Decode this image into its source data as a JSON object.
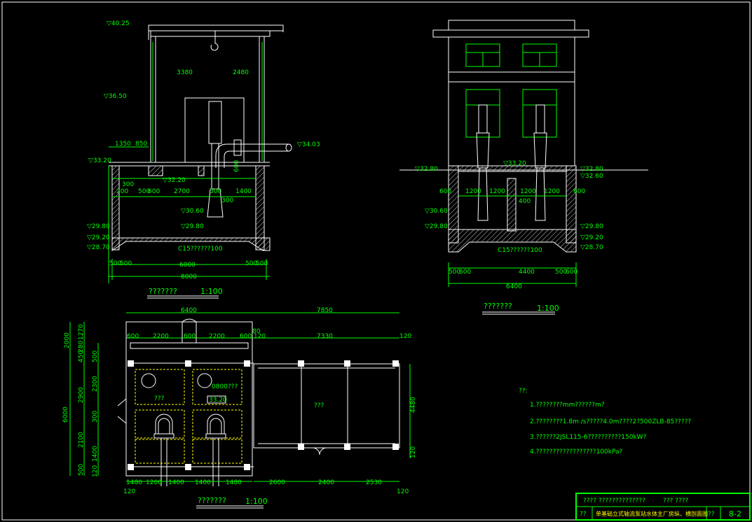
{
  "section": {
    "elevations": [
      "▽40.25",
      "▽36.50",
      "▽34.03",
      "▽33.20",
      "▽32.20",
      "▽30.60",
      "▽29.80",
      "▽29.80",
      "▽29.20",
      "▽28.70"
    ],
    "dims": [
      "3380",
      "2480",
      "1350",
      "850",
      "300",
      "200",
      "500",
      "600",
      "2700",
      "300",
      "1400",
      "300",
      "500",
      "500",
      "6000",
      "500",
      "500",
      "8000"
    ],
    "pipe_dim": "600",
    "concrete_note": "C15??????100",
    "title": "???????",
    "scale": "1:100"
  },
  "elevation": {
    "elevations": [
      "▽32.80",
      "▽33.20",
      "▽32.80",
      "▽32.60",
      "▽30.60",
      "▽29.80",
      "▽29.80",
      "▽29.20",
      "▽28.70"
    ],
    "dims": [
      "600",
      "1200",
      "1200",
      "1200",
      "1200",
      "600",
      "400",
      "500",
      "600",
      "4400",
      "500",
      "600",
      "6400"
    ],
    "concrete_note": "C15??????100",
    "title": "???????",
    "scale": "1:100"
  },
  "plan": {
    "dims_top": [
      "6400",
      "7850",
      "600",
      "2200",
      "600",
      "2200",
      "600",
      "80",
      "120",
      "7330",
      "120"
    ],
    "dims_left": [
      "2000",
      "1270",
      "280",
      "450",
      "500",
      "2300",
      "2900",
      "6000",
      "300",
      "2100",
      "1400",
      "500",
      "120"
    ],
    "dims_right": [
      "4480",
      "120"
    ],
    "dims_bottom": [
      "1480",
      "1200",
      "1400",
      "1400",
      "1480",
      "120",
      "2600",
      "2400",
      "2530",
      "120"
    ],
    "inner_note": "0800???",
    "room_a": "???",
    "room_b": "???",
    "elev_tag": "33.20",
    "title": "???????",
    "scale": "1:100"
  },
  "notes": {
    "header": "??:",
    "items": [
      "1.????????mm??????m?",
      "2.????????1.8m  /s?????4.0m????2?500ZLB-85?????",
      "3.??????2JSL115-6??????????150kW?",
      "4.??????????????????100kPa?"
    ]
  },
  "titleblock": {
    "row1": [
      "????  ??????????????",
      "???  ????"
    ],
    "row2_label": "??",
    "row2_text": "单基础立式轴流泵站水体主厂房纵、横剖面图",
    "row2_code": "??",
    "sheet": "8-2"
  }
}
